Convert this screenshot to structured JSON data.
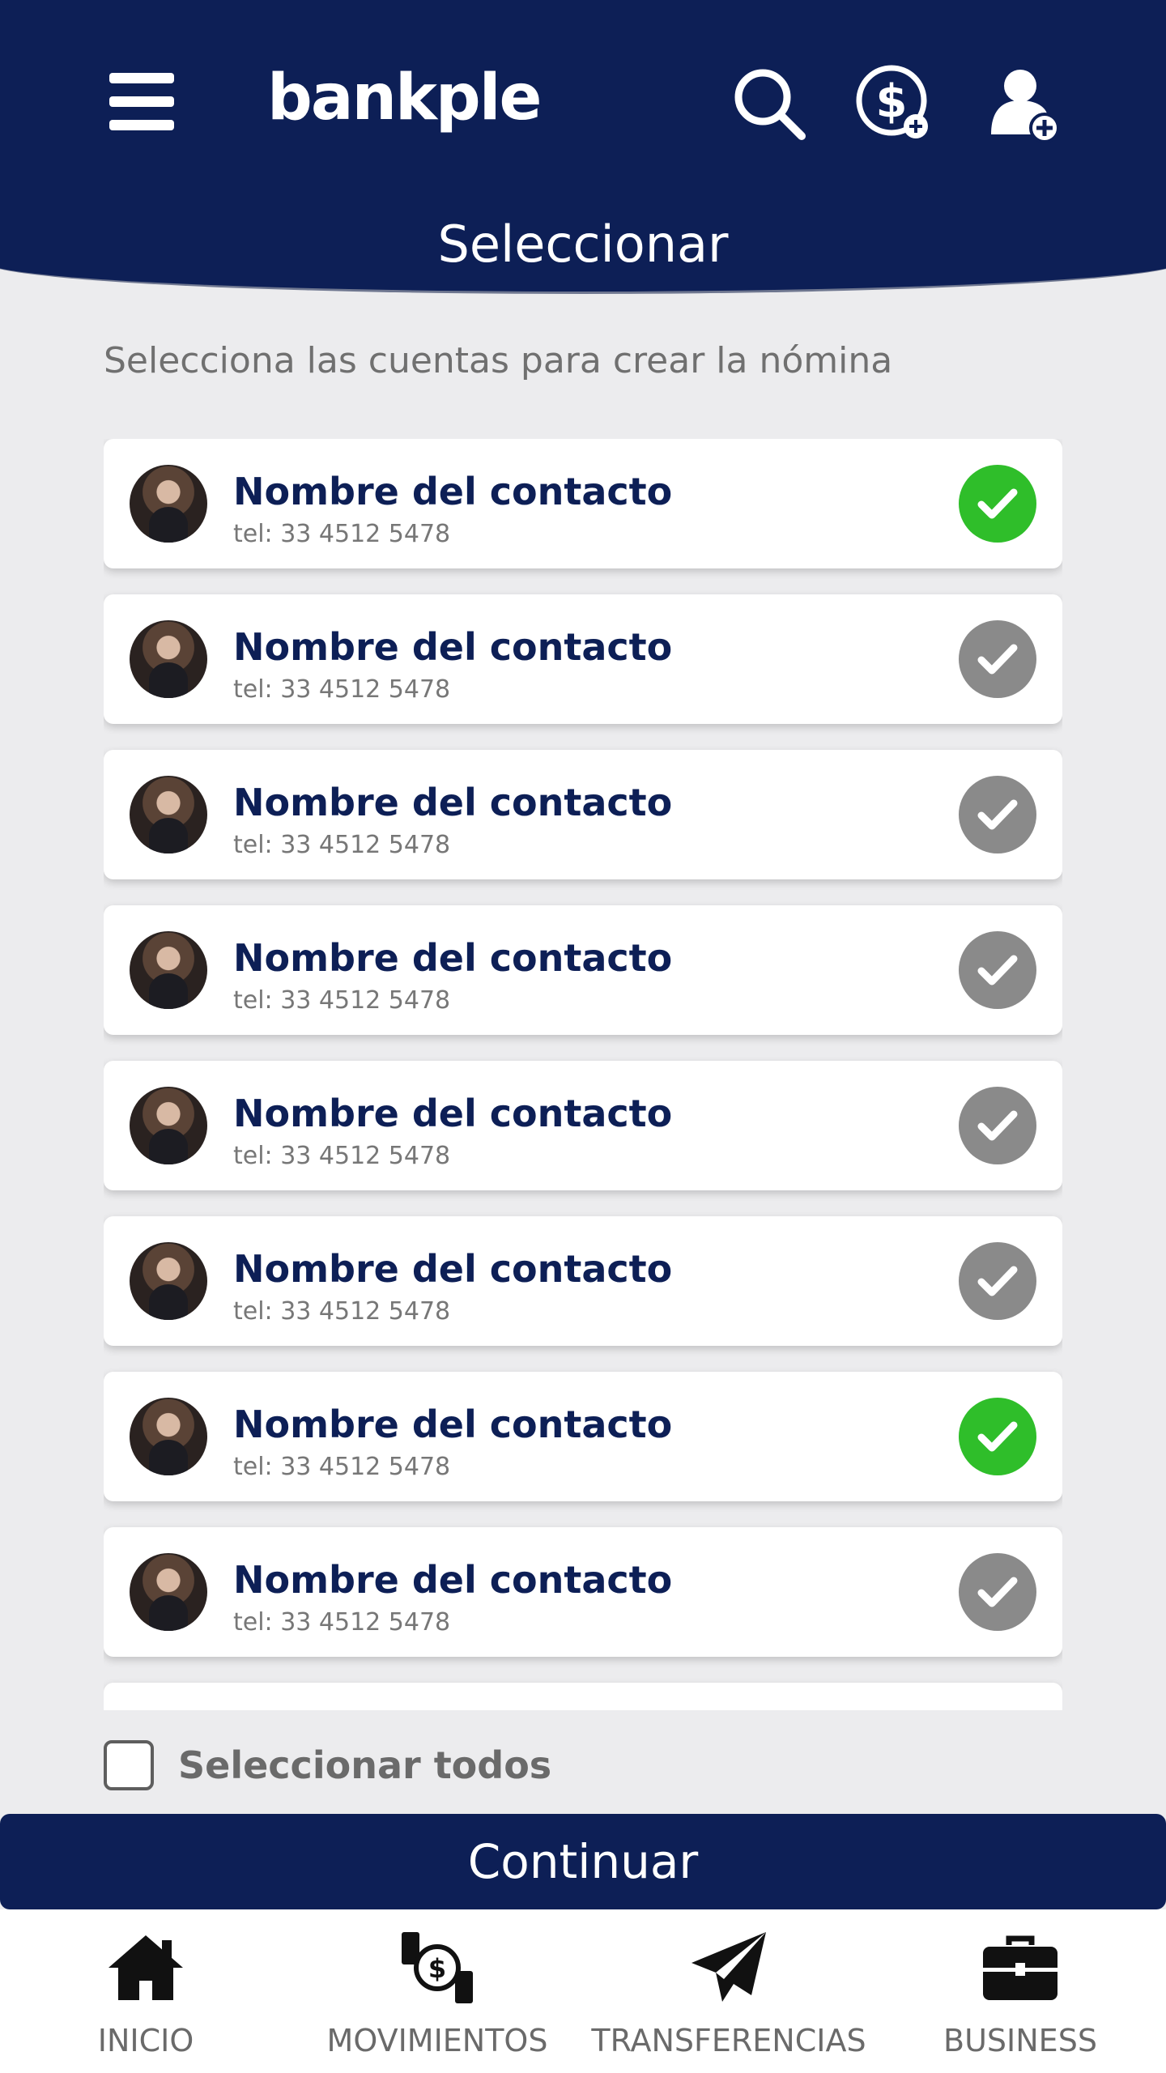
{
  "header": {
    "logo": "bankple",
    "title": "Seleccionar"
  },
  "subtitle": "Selecciona las cuentas para crear la nómina",
  "contacts": [
    {
      "name": "Nombre del contacto",
      "tel": "tel: 33 4512 5478",
      "selected": true
    },
    {
      "name": "Nombre del contacto",
      "tel": "tel: 33 4512 5478",
      "selected": false
    },
    {
      "name": "Nombre del contacto",
      "tel": "tel: 33 4512 5478",
      "selected": false
    },
    {
      "name": "Nombre del contacto",
      "tel": "tel: 33 4512 5478",
      "selected": false
    },
    {
      "name": "Nombre del contacto",
      "tel": "tel: 33 4512 5478",
      "selected": false
    },
    {
      "name": "Nombre del contacto",
      "tel": "tel: 33 4512 5478",
      "selected": false
    },
    {
      "name": "Nombre del contacto",
      "tel": "tel: 33 4512 5478",
      "selected": true
    },
    {
      "name": "Nombre del contacto",
      "tel": "tel: 33 4512 5478",
      "selected": false
    }
  ],
  "select_all_label": "Seleccionar todos",
  "continue_label": "Continuar",
  "nav": [
    {
      "label": "INICIO",
      "icon": "home-icon"
    },
    {
      "label": "MOVIMIENTOS",
      "icon": "money-exchange-icon"
    },
    {
      "label": "TRANSFERENCIAS",
      "icon": "paper-plane-icon"
    },
    {
      "label": "BUSINESS",
      "icon": "briefcase-icon"
    }
  ],
  "colors": {
    "primary": "#0d1f56",
    "selected": "#2fbe2a",
    "unselected": "#8a8a8a"
  }
}
